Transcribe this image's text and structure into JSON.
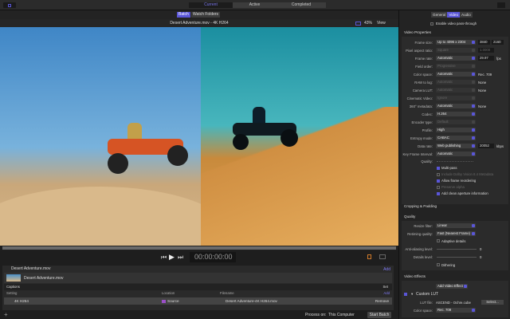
{
  "toolbar": {
    "tabs": [
      "Current",
      "Active",
      "Completed"
    ]
  },
  "batch_tabs": [
    "Batch",
    "Watch Folders"
  ],
  "preview": {
    "title": "Desert Adventure.mov - 4K H264",
    "zoom": "43%",
    "view": "View",
    "timecode": "00:00:00:00"
  },
  "batch": {
    "source": "Desert Adventure.mov",
    "add": "Add",
    "job_name": "Desert Adventure.mov",
    "captions": "Captions",
    "set": "Set",
    "columns": [
      "Setting",
      "Location",
      "Filename"
    ],
    "col_add": "Add",
    "row": {
      "setting": "4K H264",
      "location": "Source",
      "filename": "Desert Adventure-4K H264.mov",
      "remove": "Remove"
    }
  },
  "footer": {
    "process_on_label": "Process on:",
    "process_on": "This Computer",
    "start": "Start Batch"
  },
  "inspector": {
    "tabs": [
      "General",
      "Video",
      "Audio"
    ],
    "passthrough": "Enable video pass-through",
    "video_properties": "Video Properties",
    "rows": [
      {
        "label": "Frame size:",
        "value": "Up to 4096 x 2304",
        "extra": "3840",
        "extra2": "2160"
      },
      {
        "label": "Pixel aspect ratio:",
        "value": "Square",
        "extra": "1.0000",
        "disabled": true
      },
      {
        "label": "Frame rate:",
        "value": "Automatic",
        "extra": "29.97",
        "unit": "fps"
      },
      {
        "label": "Field order:",
        "value": "Progressive",
        "disabled": true
      },
      {
        "label": "Color space:",
        "value": "Automatic",
        "note": "Rec. 709"
      },
      {
        "label": "RAW to log:",
        "value": "Automatic",
        "note": "None",
        "disabled": true
      },
      {
        "label": "Camera LUT:",
        "value": "Automatic",
        "note": "None",
        "disabled": true
      },
      {
        "label": "Cinematic Video:",
        "value": "Ignore",
        "disabled": true
      },
      {
        "label": "360° metadata:",
        "value": "Automatic",
        "note": "None"
      },
      {
        "label": "Codec:",
        "value": "H.264"
      },
      {
        "label": "Encoder type:",
        "value": "Default",
        "disabled": true
      },
      {
        "label": "Profile:",
        "value": "High"
      },
      {
        "label": "Entropy mode:",
        "value": "CABAC"
      },
      {
        "label": "Data rate:",
        "value": "Web publishing",
        "extra": "20052",
        "unit": "kbps"
      },
      {
        "label": "Key Frame Interval:",
        "value": "Automatic"
      }
    ],
    "quality_label": "Quality:",
    "checks": [
      {
        "label": "Multi-pass",
        "on": true
      },
      {
        "label": "Include Dolby Vision 8.4 Metadata",
        "on": false,
        "disabled": true
      },
      {
        "label": "Allow frame reordering",
        "on": true
      },
      {
        "label": "Preserve alpha",
        "on": false,
        "disabled": true
      },
      {
        "label": "Add clean aperture information",
        "on": true
      }
    ],
    "cropping": "Cropping & Padding",
    "quality": "Quality",
    "resize_label": "Resize filter:",
    "resize": "Linear",
    "retiming_label": "Retiming quality:",
    "retiming": "Fast (Nearest Frame)",
    "adaptive": "Adaptive details",
    "antialias_label": "Anti-aliasing level:",
    "antialias": "0",
    "details_label": "Details level:",
    "details": "0",
    "dithering": "Dithering",
    "effects": "Video Effects",
    "add_effect": "Add Video Effect",
    "custom_lut": "Custom LUT",
    "lut_file_label": "LUT file:",
    "lut_file": "ASCEND - Ochre.cube",
    "select": "Select...",
    "lut_cs_label": "Color space:",
    "lut_cs": "Rec. 709"
  },
  "colors": {
    "accent": "#5a56d8"
  }
}
